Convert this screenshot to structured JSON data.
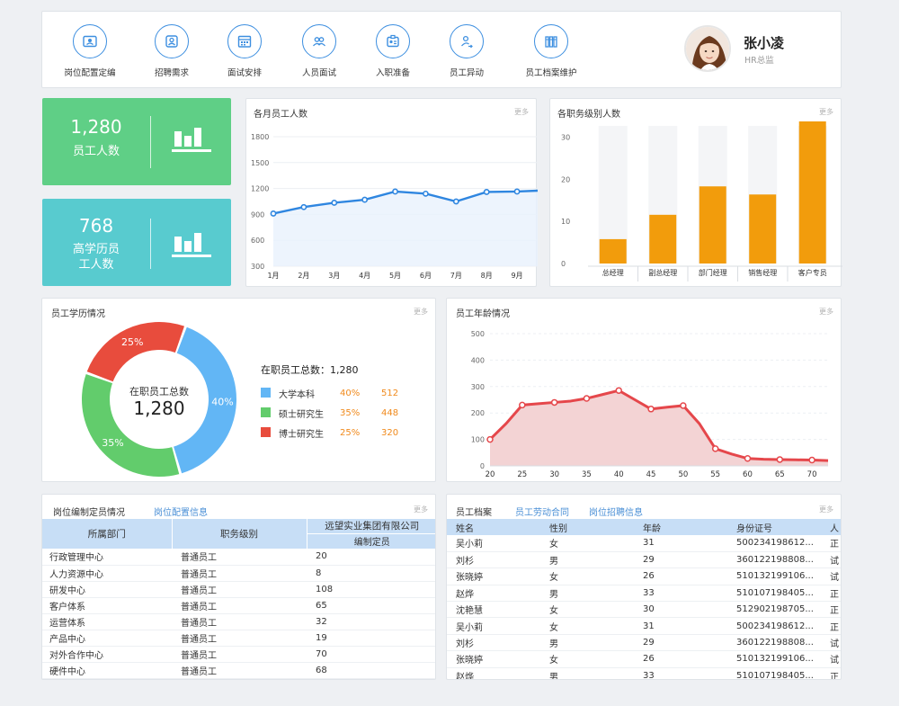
{
  "nav": [
    {
      "label": "岗位配置定编",
      "icon": "id-card-icon"
    },
    {
      "label": "招聘需求",
      "icon": "contact-icon"
    },
    {
      "label": "面试安排",
      "icon": "calendar-icon"
    },
    {
      "label": "人员面试",
      "icon": "group-icon"
    },
    {
      "label": "入职准备",
      "icon": "badge-icon"
    },
    {
      "label": "员工异动",
      "icon": "user-transfer-icon"
    },
    {
      "label": "员工档案维护",
      "icon": "archive-icon"
    }
  ],
  "user": {
    "name": "张小凌",
    "role": "HR总监"
  },
  "stats": {
    "employees": {
      "value": "1,280",
      "label": "员工人数",
      "color": "#5fcf86"
    },
    "high_edu": {
      "value": "768",
      "label_line1": "高学历员",
      "label_line2": "工人数",
      "color": "#58cbcf"
    }
  },
  "monthly_panel": {
    "title": "各月员工人数",
    "more": "更多"
  },
  "rank_panel": {
    "title": "各职务级别人数",
    "more": "更多"
  },
  "edu_panel": {
    "title": "员工学历情况",
    "more": "更多",
    "center_line1": "在职员工总数",
    "center_value": "1,280",
    "total_label": "在职员工总数：1,280"
  },
  "age_panel": {
    "title": "员工年龄情况",
    "more": "更多"
  },
  "chart_data": [
    {
      "type": "line",
      "title": "各月员工人数",
      "categories": [
        "1月",
        "2月",
        "3月",
        "4月",
        "5月",
        "6月",
        "7月",
        "8月",
        "9月"
      ],
      "values": [
        910,
        985,
        1035,
        1070,
        1165,
        1140,
        1050,
        1160,
        1165
      ],
      "y_ticks": [
        300,
        600,
        900,
        1200,
        1500,
        1800
      ],
      "ylim": [
        300,
        1800
      ],
      "color": "#2f86e0"
    },
    {
      "type": "bar",
      "title": "各职务级别人数",
      "categories": [
        "总经理",
        "副总经理",
        "部门经理",
        "销售经理",
        "客户专员"
      ],
      "values": [
        6,
        12,
        19,
        17,
        35
      ],
      "y_ticks": [
        0,
        10,
        20,
        30
      ],
      "ylim": [
        0,
        35
      ],
      "color": "#f29c0c"
    },
    {
      "type": "pie",
      "title": "员工学历情况",
      "slices": [
        {
          "name": "大学本科",
          "percent": 40,
          "pct_label": "40%",
          "count": "512",
          "color": "#62b6f5"
        },
        {
          "name": "硕士研究生",
          "percent": 35,
          "pct_label": "35%",
          "count": "448",
          "color": "#62cc6c"
        },
        {
          "name": "博士研究生",
          "percent": 25,
          "pct_label": "25%",
          "count": "320",
          "color": "#e84c3d"
        }
      ]
    },
    {
      "type": "area",
      "title": "员工年龄情况",
      "x": [
        20,
        22.5,
        25,
        27.5,
        30,
        32.5,
        35,
        37.5,
        40,
        42.5,
        45,
        47.5,
        50,
        52.5,
        55,
        57.5,
        60,
        62.5,
        65,
        67.5,
        70,
        72.5
      ],
      "values": [
        100,
        160,
        230,
        235,
        240,
        245,
        255,
        270,
        285,
        250,
        215,
        222,
        228,
        160,
        65,
        45,
        28,
        25,
        24,
        23,
        22,
        20
      ],
      "x_ticks": [
        20,
        25,
        30,
        35,
        40,
        45,
        50,
        55,
        60,
        65,
        70
      ],
      "y_ticks": [
        0,
        100,
        200,
        300,
        400,
        500
      ],
      "xlim": [
        20,
        72.5
      ],
      "ylim": [
        0,
        500
      ],
      "color": "#e5474b"
    }
  ],
  "positions_table": {
    "tabs": [
      "岗位编制定员情况",
      "岗位配置信息"
    ],
    "more": "更多",
    "headers": {
      "dept": "所属部门",
      "level": "职务级别",
      "company": "远望实业集团有限公司",
      "quota": "编制定员"
    },
    "rows": [
      [
        "行政管理中心",
        "普通员工",
        "20"
      ],
      [
        "人力资源中心",
        "普通员工",
        "8"
      ],
      [
        "研发中心",
        "普通员工",
        "108"
      ],
      [
        "客户体系",
        "普通员工",
        "65"
      ],
      [
        "运营体系",
        "普通员工",
        "32"
      ],
      [
        "产品中心",
        "普通员工",
        "19"
      ],
      [
        "对外合作中心",
        "普通员工",
        "70"
      ],
      [
        "硬件中心",
        "普通员工",
        "68"
      ]
    ]
  },
  "staff_table": {
    "tabs": [
      "员工档案",
      "员工劳动合同",
      "岗位招聘信息"
    ],
    "more": "更多",
    "headers": [
      "姓名",
      "性别",
      "年龄",
      "身份证号",
      "人"
    ],
    "rows": [
      [
        "吴小莉",
        "女",
        "31",
        "500234198612...",
        "正"
      ],
      [
        "刘杉",
        "男",
        "29",
        "360122198808...",
        "试"
      ],
      [
        "张晓婷",
        "女",
        "26",
        "510132199106...",
        "试"
      ],
      [
        "赵烨",
        "男",
        "33",
        "510107198405...",
        "正"
      ],
      [
        "沈艳慧",
        "女",
        "30",
        "512902198705...",
        "正"
      ],
      [
        "吴小莉",
        "女",
        "31",
        "500234198612...",
        "正"
      ],
      [
        "刘杉",
        "男",
        "29",
        "360122198808...",
        "试"
      ],
      [
        "张晓婷",
        "女",
        "26",
        "510132199106...",
        "试"
      ],
      [
        "赵烨",
        "男",
        "33",
        "510107198405...",
        "正"
      ]
    ]
  }
}
